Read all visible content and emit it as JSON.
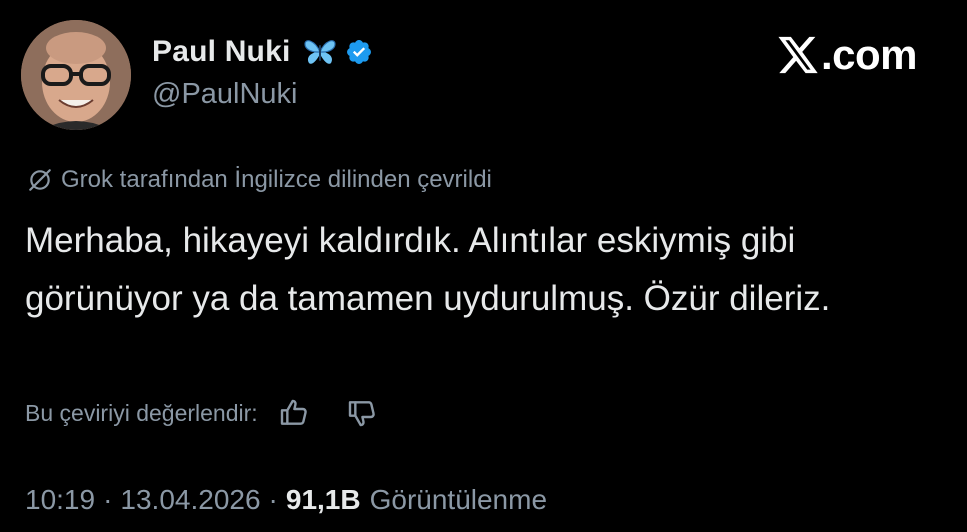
{
  "author": {
    "display_name": "Paul Nuki",
    "handle": "@PaulNuki",
    "badges": [
      "butterfly-emoji",
      "verified-badge-icon"
    ],
    "verified_color": "#1d9bf0"
  },
  "brand": {
    "label": ".com",
    "icon": "x-logo-icon"
  },
  "translation_notice": {
    "text": "Grok tarafından İngilizce dilinden çevrildi",
    "icon": "grok-icon"
  },
  "tweet": {
    "text": "Merhaba, hikayeyi kaldırdık. Alıntılar eskiymiş gibi görünüyor ya da tamamen uydurulmuş. Özür dileriz."
  },
  "rating": {
    "label": "Bu çeviriyi değerlendir:",
    "icons": [
      "thumbs-up-icon",
      "thumbs-down-icon"
    ]
  },
  "meta": {
    "time": "10:19",
    "separator": "·",
    "date": "13.04.2026",
    "views_count": "91,1B",
    "views_label": "Görüntülenme"
  },
  "colors": {
    "background": "#000000",
    "primary_text": "#e7e9ea",
    "secondary_text": "#8b98a5",
    "accent": "#1d9bf0"
  }
}
